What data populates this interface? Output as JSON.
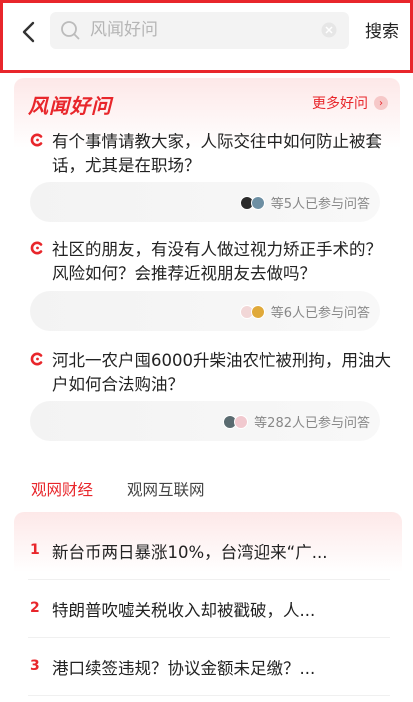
{
  "search": {
    "placeholder": "风闻好问",
    "button_label": "搜索"
  },
  "qa_section": {
    "title": "风闻好问",
    "more_label": "更多好问",
    "questions": [
      {
        "text": "有个事情请教大家，人际交往中如何防止被套话，尤其是在职场？",
        "participants": "等5人已参与问答"
      },
      {
        "text": "社区的朋友，有没有人做过视力矫正手术的？风险如何？会推荐近视朋友去做吗？",
        "participants": "等6人已参与问答"
      },
      {
        "text": "河北一农户囤6000升柴油农忙被刑拘，用油大户如何合法购油？",
        "participants": "等282人已参与问答"
      }
    ]
  },
  "tabs": [
    {
      "label": "观网财经",
      "active": true
    },
    {
      "label": "观网互联网",
      "active": false
    }
  ],
  "news": [
    {
      "rank": "1",
      "title": "新台币两日暴涨10%，台湾迎来“广..."
    },
    {
      "rank": "2",
      "title": "特朗普吹嘘关税收入却被戳破，人..."
    },
    {
      "rank": "3",
      "title": "港口续签违规？协议金额未足缴？..."
    }
  ],
  "colors": {
    "accent": "#e8262b"
  }
}
